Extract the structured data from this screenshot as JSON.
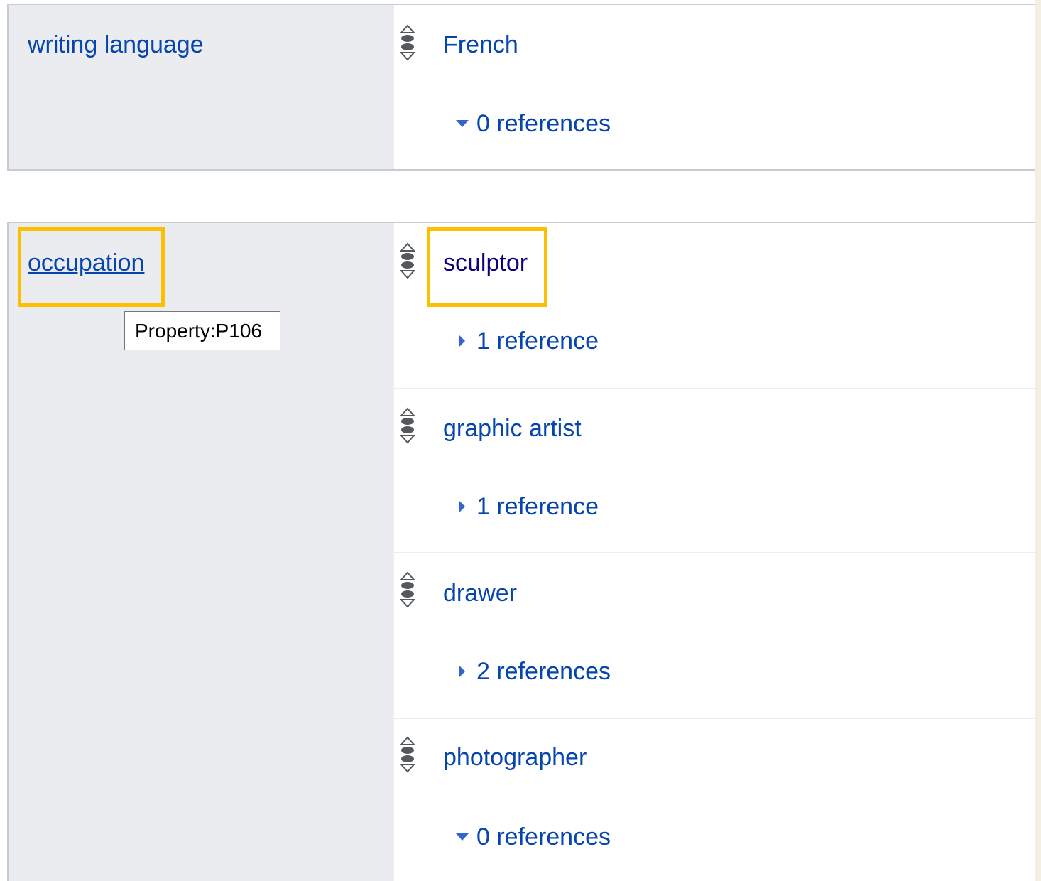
{
  "writing_language": {
    "property_label": "writing language",
    "values": [
      {
        "label": "French",
        "references": "0 references",
        "references_expanded": true
      }
    ]
  },
  "occupation": {
    "property_label": "occupation",
    "tooltip": "Property:P106",
    "values": [
      {
        "label": "sculptor",
        "references": "1 reference",
        "references_expanded": false,
        "highlighted": true
      },
      {
        "label": "graphic artist",
        "references": "1 reference",
        "references_expanded": false
      },
      {
        "label": "drawer",
        "references": "2 references",
        "references_expanded": false
      },
      {
        "label": "photographer",
        "references": "0 references",
        "references_expanded": true
      }
    ]
  },
  "colors": {
    "link": "#0645ad",
    "visited_link": "#0b0080",
    "highlight": "#fdc000",
    "property_background": "#eaecf0",
    "border": "#c8ccd1"
  },
  "icons": {
    "rank": "rank-selector-icon",
    "expand_collapsed": "triangle-right-icon",
    "expand_open": "triangle-down-icon"
  }
}
